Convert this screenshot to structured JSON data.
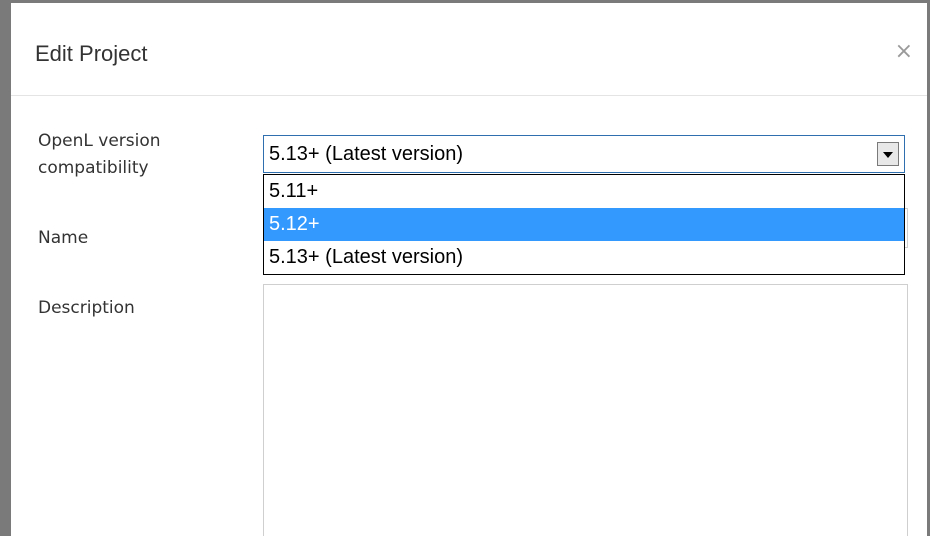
{
  "dialog": {
    "title": "Edit Project",
    "close_glyph": "×"
  },
  "form": {
    "compatibility": {
      "label": "OpenL version compatibility",
      "selected_value": "5.13+ (Latest version)",
      "options": [
        {
          "label": "5.11+",
          "highlighted": false
        },
        {
          "label": "5.12+",
          "highlighted": true
        },
        {
          "label": "5.13+ (Latest version)",
          "highlighted": false
        }
      ]
    },
    "name": {
      "label": "Name",
      "value": ""
    },
    "description": {
      "label": "Description",
      "value": ""
    }
  },
  "colors": {
    "highlight": "#3399ff",
    "frame": "#7a7a7a",
    "select_border": "#2f6fb0"
  },
  "icons": {
    "close": "close-icon",
    "dropdown": "chevron-down-icon"
  }
}
